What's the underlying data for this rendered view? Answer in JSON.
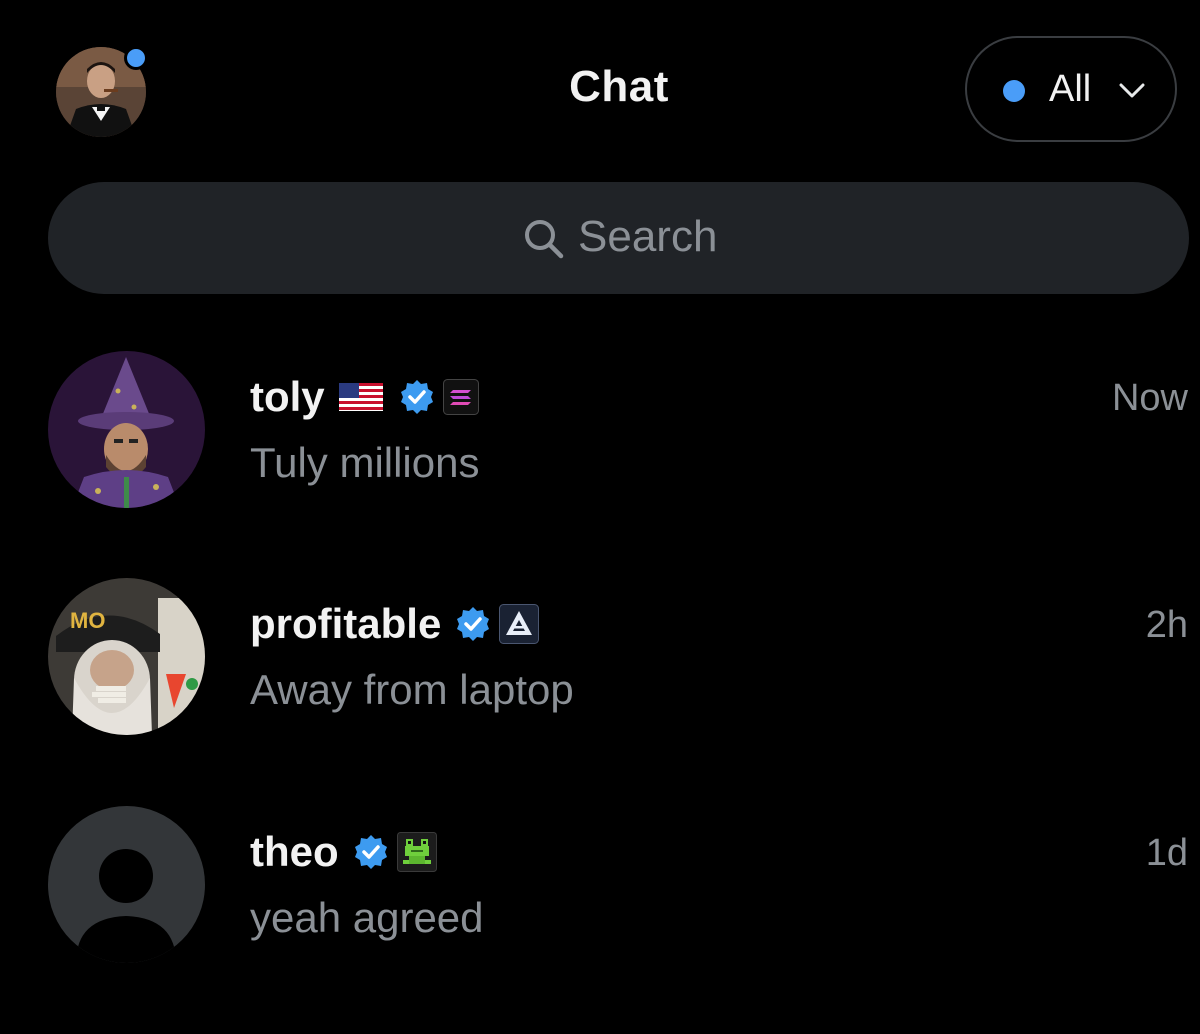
{
  "header": {
    "title": "Chat",
    "profile_icon": "user-avatar-photo",
    "notification_dot_color": "#4a9df8",
    "filter": {
      "label": "All",
      "dot_color": "#4a9df8",
      "icon": "chevron-down-icon"
    }
  },
  "search": {
    "placeholder": "Search",
    "icon": "search-icon"
  },
  "colors": {
    "background": "#000000",
    "search_background": "#202327",
    "primary_text": "#f2f2f2",
    "secondary_text": "#8b9096",
    "verified_blue": "#3d9bf0"
  },
  "chats": [
    {
      "name": "toly",
      "preview": "Tuly millions",
      "time": "Now",
      "verified": true,
      "badges": [
        "us-flag-icon",
        "solana-logo-icon"
      ],
      "avatar": "wizard-avatar"
    },
    {
      "name": "profitable",
      "preview": "Away from laptop",
      "time": "2h",
      "verified": true,
      "badges": [
        "triangle-logo-icon"
      ],
      "avatar": "photo-avatar"
    },
    {
      "name": "theo",
      "preview": "yeah agreed",
      "time": "1d",
      "verified": true,
      "badges": [
        "frog-pixel-icon"
      ],
      "avatar": "default-avatar"
    }
  ]
}
